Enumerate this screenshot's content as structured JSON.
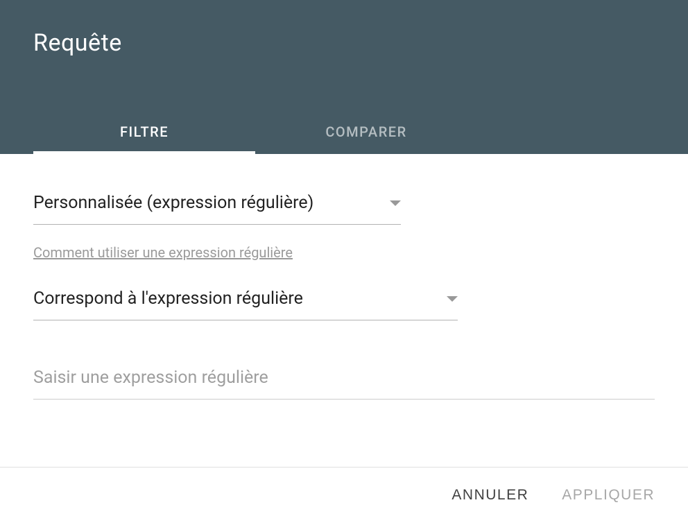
{
  "header": {
    "title": "Requête",
    "tabs": {
      "filter": "FILTRE",
      "compare": "COMPARER"
    }
  },
  "form": {
    "filter_type": {
      "selected": "Personnalisée (expression régulière)"
    },
    "help_link": "Comment utiliser une expression régulière",
    "match_type": {
      "selected": "Correspond à l'expression régulière"
    },
    "input": {
      "placeholder": "Saisir une expression régulière",
      "value": ""
    }
  },
  "footer": {
    "cancel": "ANNULER",
    "apply": "APPLIQUER"
  }
}
